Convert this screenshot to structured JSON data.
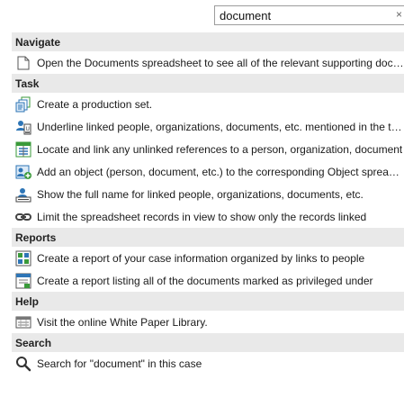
{
  "search": {
    "value": "document",
    "clear_glyph": "×"
  },
  "sections": {
    "navigate": {
      "title": "Navigate",
      "items": [
        {
          "label": "Open the Documents spreadsheet to see all of the relevant supporting documents",
          "icon": "document-icon"
        }
      ]
    },
    "task": {
      "title": "Task",
      "items": [
        {
          "label": "Create a production set.",
          "icon": "production-set-icon"
        },
        {
          "label": "Underline linked people, organizations, documents, etc. mentioned in the text",
          "icon": "underline-link-icon"
        },
        {
          "label": "Locate and link any unlinked references to a person, organization, document",
          "icon": "locate-link-icon"
        },
        {
          "label": "Add an object (person, document, etc.) to the corresponding Object spreadsheet",
          "icon": "add-object-icon"
        },
        {
          "label": "Show the full name for linked people, organizations, documents, etc.",
          "icon": "full-name-icon"
        },
        {
          "label": "Limit the spreadsheet records in view to show only the records linked",
          "icon": "link-chain-icon"
        }
      ]
    },
    "reports": {
      "title": "Reports",
      "items": [
        {
          "label": "Create a report of your case information organized by links to people",
          "icon": "report-links-icon"
        },
        {
          "label": "Create a report listing all of the documents marked as privileged under",
          "icon": "report-privileged-icon"
        }
      ]
    },
    "help": {
      "title": "Help",
      "items": [
        {
          "label": "Visit the online White Paper Library.",
          "icon": "web-library-icon"
        }
      ]
    },
    "search": {
      "title": "Search",
      "items": [
        {
          "label": "Search for \"document\" in this case",
          "icon": "search-icon"
        }
      ]
    }
  },
  "colors": {
    "section_bg": "#e9e9e9",
    "icon_blue": "#2e75b6",
    "icon_green": "#3a9a3a",
    "icon_dark": "#444444"
  }
}
